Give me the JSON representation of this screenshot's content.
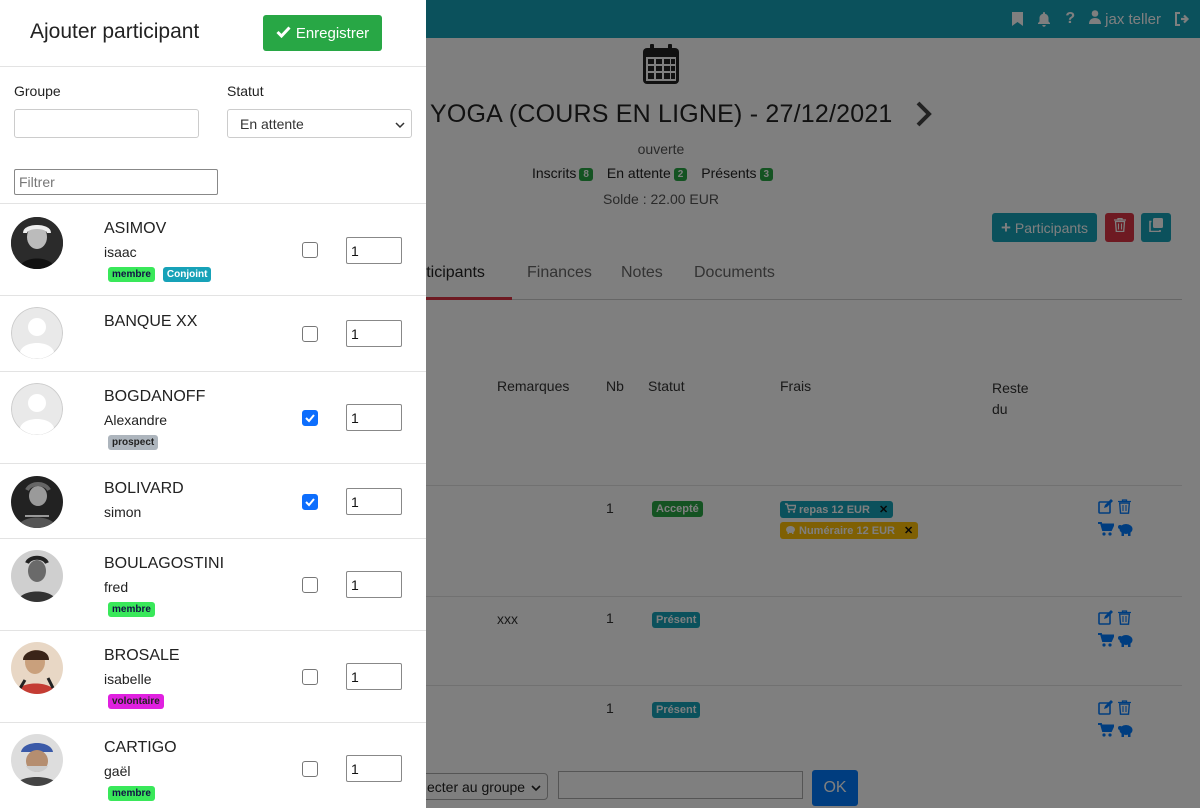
{
  "topbar": {
    "user_name": "jax teller",
    "color": "#17a2b8"
  },
  "event": {
    "title": "YOGA (COURS EN LIGNE) - 27/12/2021",
    "status": "ouverte",
    "counts": [
      {
        "label": "Inscrits",
        "value": "8"
      },
      {
        "label": "En attente",
        "value": "2"
      },
      {
        "label": "Présents",
        "value": "3"
      }
    ],
    "solde": "Solde : 22.00 EUR"
  },
  "toolbar": {
    "participants_label": "Participants"
  },
  "tabs": [
    {
      "label": "articipants",
      "active": true
    },
    {
      "label": "Finances",
      "active": false
    },
    {
      "label": "Notes",
      "active": false
    },
    {
      "label": "Documents",
      "active": false
    }
  ],
  "table": {
    "headers": {
      "remarks": "Remarques",
      "nb": "Nb",
      "status": "Statut",
      "fees": "Frais",
      "due": "Reste du"
    },
    "rows": [
      {
        "remarks": "",
        "nb": "1",
        "status": "Accepté",
        "status_color": "#28a745",
        "fees": [
          {
            "label": "repas 12 EUR",
            "color": "#17a2b8"
          },
          {
            "label": "Numéraire 12 EUR",
            "color": "#ffc107"
          }
        ]
      },
      {
        "remarks": "xxx",
        "nb": "1",
        "status": "Présent",
        "status_color": "#17a2b8",
        "fees": []
      },
      {
        "remarks": "",
        "nb": "1",
        "status": "Présent",
        "status_color": "#17a2b8",
        "fees": []
      }
    ]
  },
  "bottom": {
    "select_value": "ecter au groupe",
    "ok_label": "OK"
  },
  "panel": {
    "title": "Ajouter participant",
    "save_label": "Enregistrer",
    "group_label": "Groupe",
    "group_value": "",
    "status_label": "Statut",
    "status_value": "En attente",
    "filter_placeholder": "Filtrer",
    "people": [
      {
        "last": "ASIMOV",
        "first": "isaac",
        "checked": false,
        "qty": "1",
        "avatar": "photo",
        "tags": [
          {
            "label": "membre",
            "color": "#39e85a"
          },
          {
            "label": "Conjoint",
            "color": "#17a2b8"
          }
        ]
      },
      {
        "last": "BANQUE XX",
        "first": "",
        "checked": false,
        "qty": "1",
        "avatar": "placeholder",
        "tags": []
      },
      {
        "last": "BOGDANOFF",
        "first": "Alexandre",
        "checked": true,
        "qty": "1",
        "avatar": "placeholder",
        "tags": [
          {
            "label": "prospect",
            "color": "#adb5bd"
          }
        ]
      },
      {
        "last": "BOLIVARD",
        "first": "simon",
        "checked": true,
        "qty": "1",
        "avatar": "photo",
        "tags": []
      },
      {
        "last": "BOULAGOSTINI",
        "first": "fred",
        "checked": false,
        "qty": "1",
        "avatar": "photo",
        "tags": [
          {
            "label": "membre",
            "color": "#39e85a"
          }
        ]
      },
      {
        "last": "BROSALE",
        "first": "isabelle",
        "checked": false,
        "qty": "1",
        "avatar": "photo",
        "tags": [
          {
            "label": "volontaire",
            "color": "#e020e0"
          }
        ]
      },
      {
        "last": "CARTIGO",
        "first": "gaël",
        "checked": false,
        "qty": "1",
        "avatar": "photo",
        "tags": [
          {
            "label": "membre",
            "color": "#39e85a"
          }
        ]
      }
    ]
  }
}
